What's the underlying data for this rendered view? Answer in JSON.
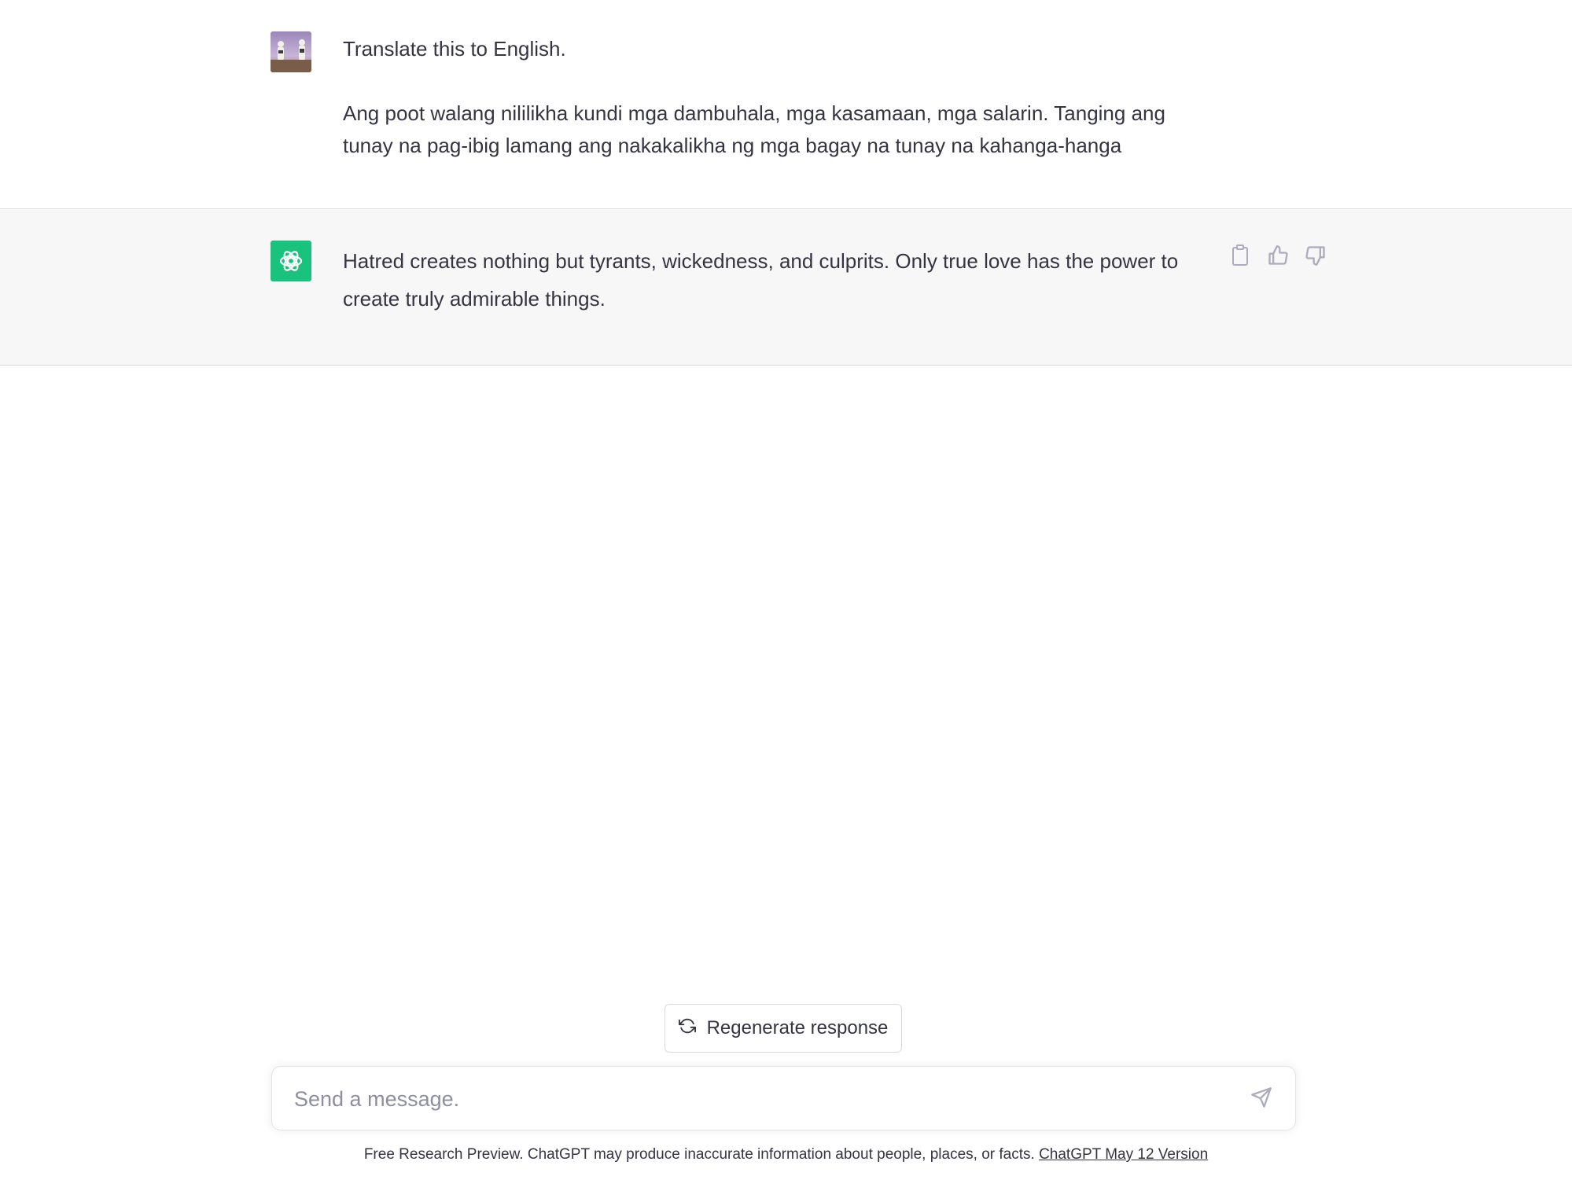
{
  "conversation": {
    "user_message": {
      "line1": "Translate this to English.",
      "line2": "Ang poot walang nililikha kundi mga dambuhala, mga kasamaan, mga salarin. Tanging ang tunay na pag-ibig lamang ang nakakalikha ng mga bagay na tunay na kahanga-hanga"
    },
    "assistant_message": {
      "text": "Hatred creates nothing but tyrants, wickedness, and culprits. Only true love has the power to create truly admirable things."
    }
  },
  "icons": {
    "copy": "clipboard-icon",
    "like": "thumbs-up-icon",
    "dislike": "thumbs-down-icon",
    "regenerate": "refresh-icon",
    "send": "send-icon",
    "assistant_logo": "openai-logo-icon"
  },
  "regenerate": {
    "label": "Regenerate response"
  },
  "composer": {
    "placeholder": "Send a message."
  },
  "footer": {
    "text": "Free Research Preview. ChatGPT may produce inaccurate information about people, places, or facts. ",
    "link": "ChatGPT May 12 Version"
  },
  "colors": {
    "accent": "#19c37d",
    "assistant_bg": "#f7f7f8",
    "text": "#343541",
    "muted": "#8e8ea0"
  }
}
